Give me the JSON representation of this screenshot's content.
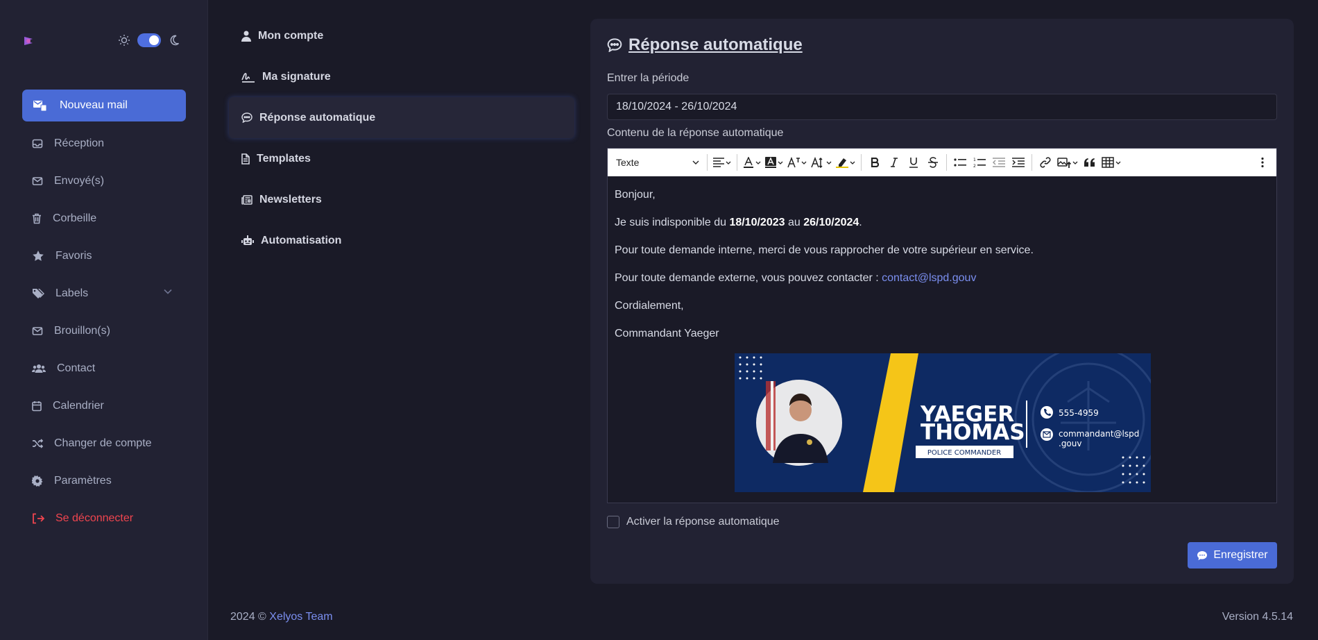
{
  "colors": {
    "accent": "#4a6bd6",
    "danger": "#f0454f",
    "link": "#7b8ff0",
    "bg": "#1a1a27",
    "panel": "#222233"
  },
  "sidebar": {
    "new_mail_label": "Nouveau mail",
    "items": [
      {
        "label": "Réception",
        "icon": "inbox-icon"
      },
      {
        "label": "Envoyé(s)",
        "icon": "envelope-icon"
      },
      {
        "label": "Corbeille",
        "icon": "trash-icon"
      },
      {
        "label": "Favoris",
        "icon": "star-icon"
      },
      {
        "label": "Labels",
        "icon": "tags-icon"
      },
      {
        "label": "Brouillon(s)",
        "icon": "envelope-icon"
      },
      {
        "label": "Contact",
        "icon": "users-icon"
      },
      {
        "label": "Calendrier",
        "icon": "calendar-icon"
      },
      {
        "label": "Changer de compte",
        "icon": "shuffle-icon"
      },
      {
        "label": "Paramètres",
        "icon": "gear-icon"
      },
      {
        "label": "Se déconnecter",
        "icon": "logout-icon"
      }
    ]
  },
  "settings_menu": [
    {
      "label": "Mon compte",
      "icon": "user-icon"
    },
    {
      "label": "Ma signature",
      "icon": "signature-icon"
    },
    {
      "label": "Réponse automatique",
      "icon": "comment-icon",
      "active": true
    },
    {
      "label": "Templates",
      "icon": "file-icon"
    },
    {
      "label": "Newsletters",
      "icon": "newspaper-icon"
    },
    {
      "label": "Automatisation",
      "icon": "robot-icon"
    }
  ],
  "card": {
    "title": "Réponse automatique",
    "period_label": "Entrer la période",
    "period_value": "18/10/2024 - 26/10/2024",
    "content_label": "Contenu de la réponse automatique",
    "toolbar": {
      "style_select": "Texte"
    },
    "body": {
      "line1": "Bonjour,",
      "line2_a": "Je suis indisponible du ",
      "line2_date1": "18/10/2023",
      "line2_b": " au ",
      "line2_date2": "26/10/2024",
      "line2_c": ".",
      "line3": "Pour toute demande interne, merci de vous rapprocher de votre supérieur en service.",
      "line4_a": "Pour toute demande externe, vous pouvez contacter : ",
      "line4_link": "contact@lspd.gouv",
      "line5": "Cordialement,",
      "line6": "Commandant Yaeger"
    },
    "signature": {
      "first_name": "YAEGER",
      "last_name": "THOMAS",
      "role": "POLICE COMMANDER",
      "phone": "555-4959",
      "email_line1": "commandant@lspd",
      "email_line2": ".gouv"
    },
    "activate_label": "Activer la réponse automatique",
    "save_label": "Enregistrer"
  },
  "footer": {
    "copyright": "2024 © ",
    "team": "Xelyos Team",
    "version": "Version 4.5.14"
  }
}
